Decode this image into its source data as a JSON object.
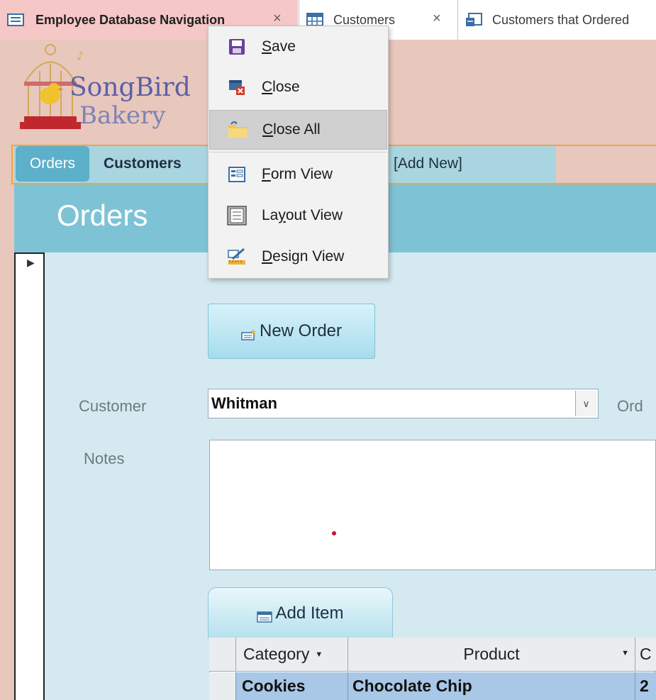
{
  "tabs": [
    {
      "label": "Employee Database Navigation",
      "close": "×"
    },
    {
      "label": "Customers",
      "close": "×"
    },
    {
      "label": "Customers that Ordered"
    }
  ],
  "logo": {
    "line1": "SongBird",
    "line2": "Bakery"
  },
  "nav": {
    "orders": "Orders",
    "customers": "Customers",
    "add_new": "[Add New]"
  },
  "form": {
    "title": "Orders",
    "new_order_label": "New Order",
    "customer_label": "Customer",
    "customer_value": "Whitman",
    "order_label": "Ord",
    "notes_label": "Notes",
    "add_item_label": "Add Item"
  },
  "grid": {
    "columns": [
      "Category",
      "Product",
      "C"
    ],
    "rows": [
      [
        "Cookies",
        "Chocolate Chip",
        "2"
      ]
    ]
  },
  "context_menu": {
    "items": [
      {
        "label": "Save",
        "mnemonic": "S",
        "icon": "save-icon"
      },
      {
        "label": "Close",
        "mnemonic": "C",
        "icon": "close-doc-icon"
      },
      {
        "label": "Close All",
        "mnemonic": "C",
        "icon": "close-all-icon"
      },
      {
        "label": "Form View",
        "mnemonic": "F",
        "icon": "form-view-icon"
      },
      {
        "label": "Layout View",
        "mnemonic": "y",
        "icon": "layout-view-icon"
      },
      {
        "label": "Design View",
        "mnemonic": "D",
        "icon": "design-view-icon"
      }
    ]
  },
  "colors": {
    "accent_orange": "#f2a43a",
    "form_header": "#7ec3d5",
    "form_body": "#d4eaf0",
    "header_bg": "#e8c7bc",
    "active_tab": "#f5c7c7"
  }
}
